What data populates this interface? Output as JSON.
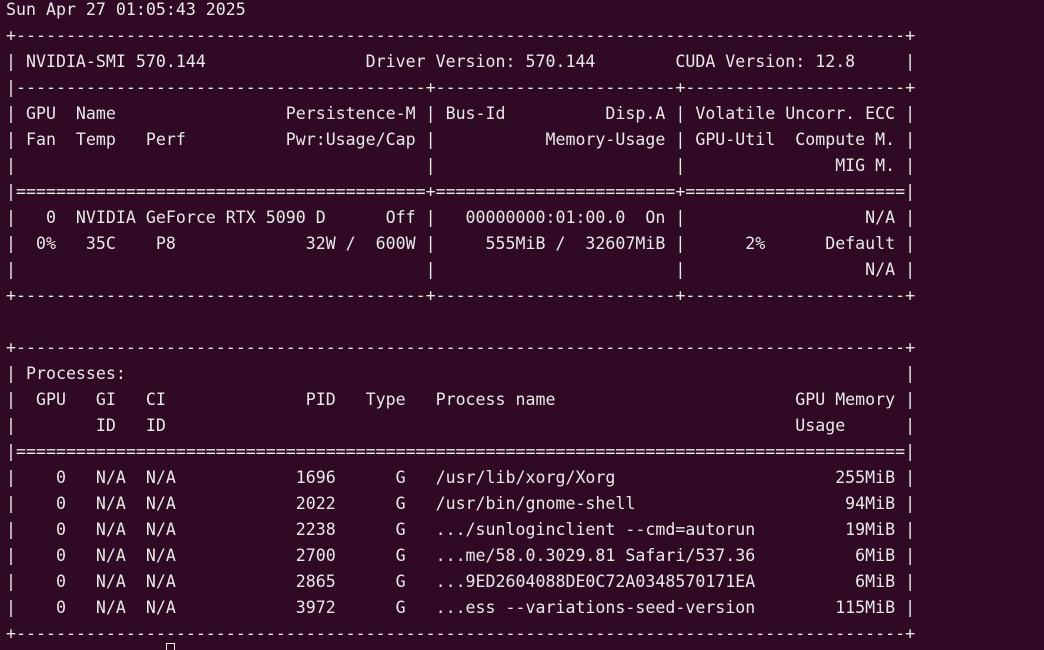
{
  "terminal": {
    "lines": [
      "Sun Apr 27 01:05:43 2025",
      "+-----------------------------------------------------------------------------------------+",
      "| NVIDIA-SMI 570.144                Driver Version: 570.144        CUDA Version: 12.8     |",
      "|-----------------------------------------+------------------------+----------------------+",
      "| GPU  Name                 Persistence-M | Bus-Id          Disp.A | Volatile Uncorr. ECC |",
      "| Fan  Temp   Perf          Pwr:Usage/Cap |           Memory-Usage | GPU-Util  Compute M. |",
      "|                                         |                        |               MIG M. |",
      "|=========================================+========================+======================|",
      "|   0  NVIDIA GeForce RTX 5090 D      Off |   00000000:01:00.0  On |                  N/A |",
      "|  0%   35C    P8             32W /  600W |     555MiB /  32607MiB |      2%      Default |",
      "|                                         |                        |                  N/A |",
      "+-----------------------------------------+------------------------+----------------------+",
      "",
      "+-----------------------------------------------------------------------------------------+",
      "| Processes:                                                                              |",
      "|  GPU   GI   CI              PID   Type   Process name                        GPU Memory |",
      "|        ID   ID                                                               Usage      |",
      "|=========================================================================================|",
      "|    0   N/A  N/A            1696      G   /usr/lib/xorg/Xorg                      255MiB |",
      "|    0   N/A  N/A            2022      G   /usr/bin/gnome-shell                     94MiB |",
      "|    0   N/A  N/A            2238      G   .../sunloginclient --cmd=autorun         19MiB |",
      "|    0   N/A  N/A            2700      G   ...me/58.0.3029.81 Safari/537.36          6MiB |",
      "|    0   N/A  N/A            2865      G   ...9ED2604088DE0C72A0348570171EA          6MiB |",
      "|    0   N/A  N/A            3972      G   ...ess --variations-seed-version        115MiB |",
      "+-----------------------------------------------------------------------------------------+"
    ]
  },
  "colors": {
    "background": "#300a24",
    "foreground": "#e8e8e8"
  }
}
